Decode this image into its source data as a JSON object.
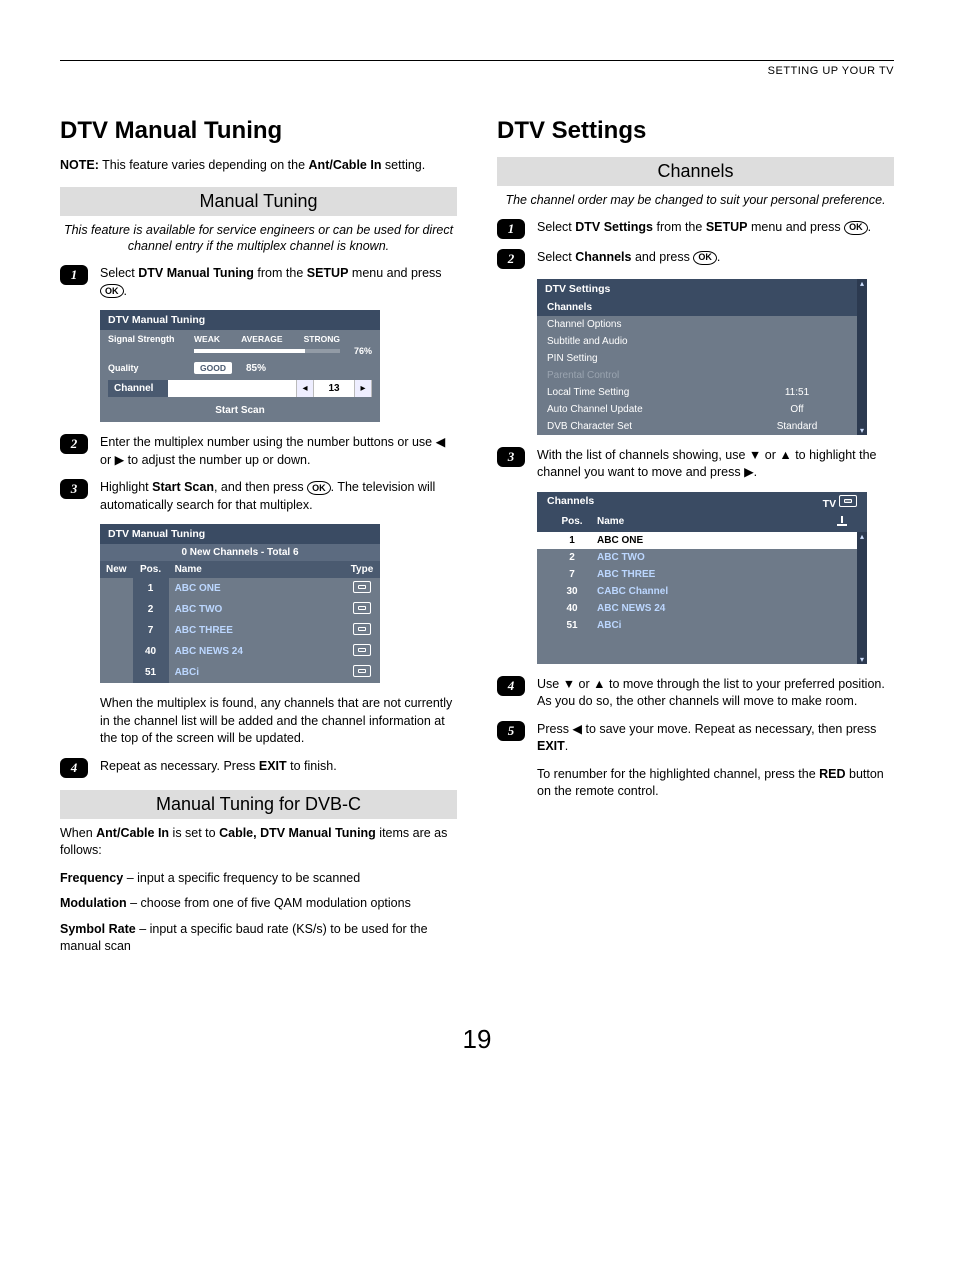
{
  "header": {
    "section": "SETTING UP YOUR TV"
  },
  "page_number": "19",
  "left": {
    "title": "DTV Manual Tuning",
    "note_prefix": "NOTE:",
    "note_text": " This feature varies depending on the ",
    "note_bold": "Ant/Cable In",
    "note_suffix": " setting.",
    "banner1": "Manual Tuning",
    "intro": "This feature is available for service engineers or can be used for direct channel entry if the multiplex channel is known.",
    "step1a": "Select ",
    "step1b": "DTV Manual Tuning",
    "step1c": " from the ",
    "step1d": "SETUP",
    "step1e": " menu and press ",
    "ok": "OK",
    "period": ".",
    "mt1": {
      "title": "DTV Manual Tuning",
      "sig_label": "Signal Strength",
      "weak": "WEAK",
      "avg": "AVERAGE",
      "strong": "STRONG",
      "pct": "76%",
      "qual_label": "Quality",
      "qual_pill": "GOOD",
      "qual_pct": "85%",
      "chan_label": "Channel",
      "chan_num": "13",
      "scan": "Start Scan"
    },
    "step2": "Enter the multiplex number using the number buttons or use ◀ or ▶ to adjust the number up or down.",
    "step3a": "Highlight ",
    "step3b": "Start Scan",
    "step3c": ", and then press ",
    "step3d": ". The television will automatically search for that multiplex.",
    "mt2": {
      "title": "DTV Manual Tuning",
      "status": "0 New Channels - Total 6",
      "cols": {
        "new": "New",
        "pos": "Pos.",
        "name": "Name",
        "type": "Type"
      },
      "rows": [
        {
          "pos": "1",
          "name": "ABC ONE"
        },
        {
          "pos": "2",
          "name": "ABC TWO"
        },
        {
          "pos": "7",
          "name": "ABC THREE"
        },
        {
          "pos": "40",
          "name": "ABC NEWS 24"
        },
        {
          "pos": "51",
          "name": "ABCi"
        }
      ],
      "after": "When the multiplex is found, any channels that are not currently in the channel list will be added and the channel information at the top of the screen will be updated."
    },
    "step4a": "Repeat as necessary. Press ",
    "step4b": "EXIT",
    "step4c": " to finish.",
    "banner2": "Manual Tuning for DVB-C",
    "dvbc_intro_a": "When ",
    "dvbc_intro_b": "Ant/Cable In",
    "dvbc_intro_c": " is set to ",
    "dvbc_intro_d": "Cable, DTV Manual Tuning",
    "dvbc_intro_e": " items are as follows:",
    "defs": [
      {
        "term": "Frequency",
        "desc": " – input a specific frequency to be scanned"
      },
      {
        "term": "Modulation",
        "desc": " – choose from one of five QAM modulation options"
      },
      {
        "term": "Symbol Rate",
        "desc": " – input a specific baud rate (KS/s) to be used for the manual scan"
      }
    ]
  },
  "right": {
    "title": "DTV Settings",
    "banner": "Channels",
    "intro": "The channel order may be changed to suit your personal preference.",
    "step1a": "Select ",
    "step1b": "DTV Settings",
    "step1c": " from the ",
    "step1d": "SETUP",
    "step1e": " menu and press ",
    "step2a": "Select ",
    "step2b": "Channels",
    "step2c": " and press ",
    "menu": {
      "title": "DTV Settings",
      "rows": [
        {
          "lab": "Channels",
          "val": "",
          "hl": true
        },
        {
          "lab": "Channel Options",
          "val": ""
        },
        {
          "lab": "Subtitle and Audio",
          "val": ""
        },
        {
          "lab": "PIN Setting",
          "val": ""
        },
        {
          "lab": "Parental Control",
          "val": "",
          "dim": true
        },
        {
          "lab": "Local Time Setting",
          "val": "11:51"
        },
        {
          "lab": "Auto Channel Update",
          "val": "Off"
        },
        {
          "lab": "DVB Character Set",
          "val": "Standard"
        }
      ]
    },
    "step3": "With the list of channels showing, use ▼ or ▲ to highlight the channel you want to move and press ▶.",
    "clist": {
      "top": "Channels",
      "tv": "TV",
      "cols": {
        "pos": "Pos.",
        "name": "Name"
      },
      "rows": [
        {
          "pos": "1",
          "name": "ABC ONE",
          "sel": true
        },
        {
          "pos": "2",
          "name": "ABC TWO"
        },
        {
          "pos": "7",
          "name": "ABC THREE"
        },
        {
          "pos": "30",
          "name": "CABC Channel"
        },
        {
          "pos": "40",
          "name": "ABC NEWS 24"
        },
        {
          "pos": "51",
          "name": "ABCi"
        }
      ]
    },
    "step4": "Use ▼ or ▲ to move through the list to your preferred position. As you do so, the other channels will move to make room.",
    "step5a": "Press ◀ to save your move. Repeat as necessary, then press ",
    "step5b": "EXIT",
    "step5c": ".",
    "tail_a": "To renumber for the highlighted channel, press the ",
    "tail_b": "RED",
    "tail_c": " button on the remote control."
  }
}
